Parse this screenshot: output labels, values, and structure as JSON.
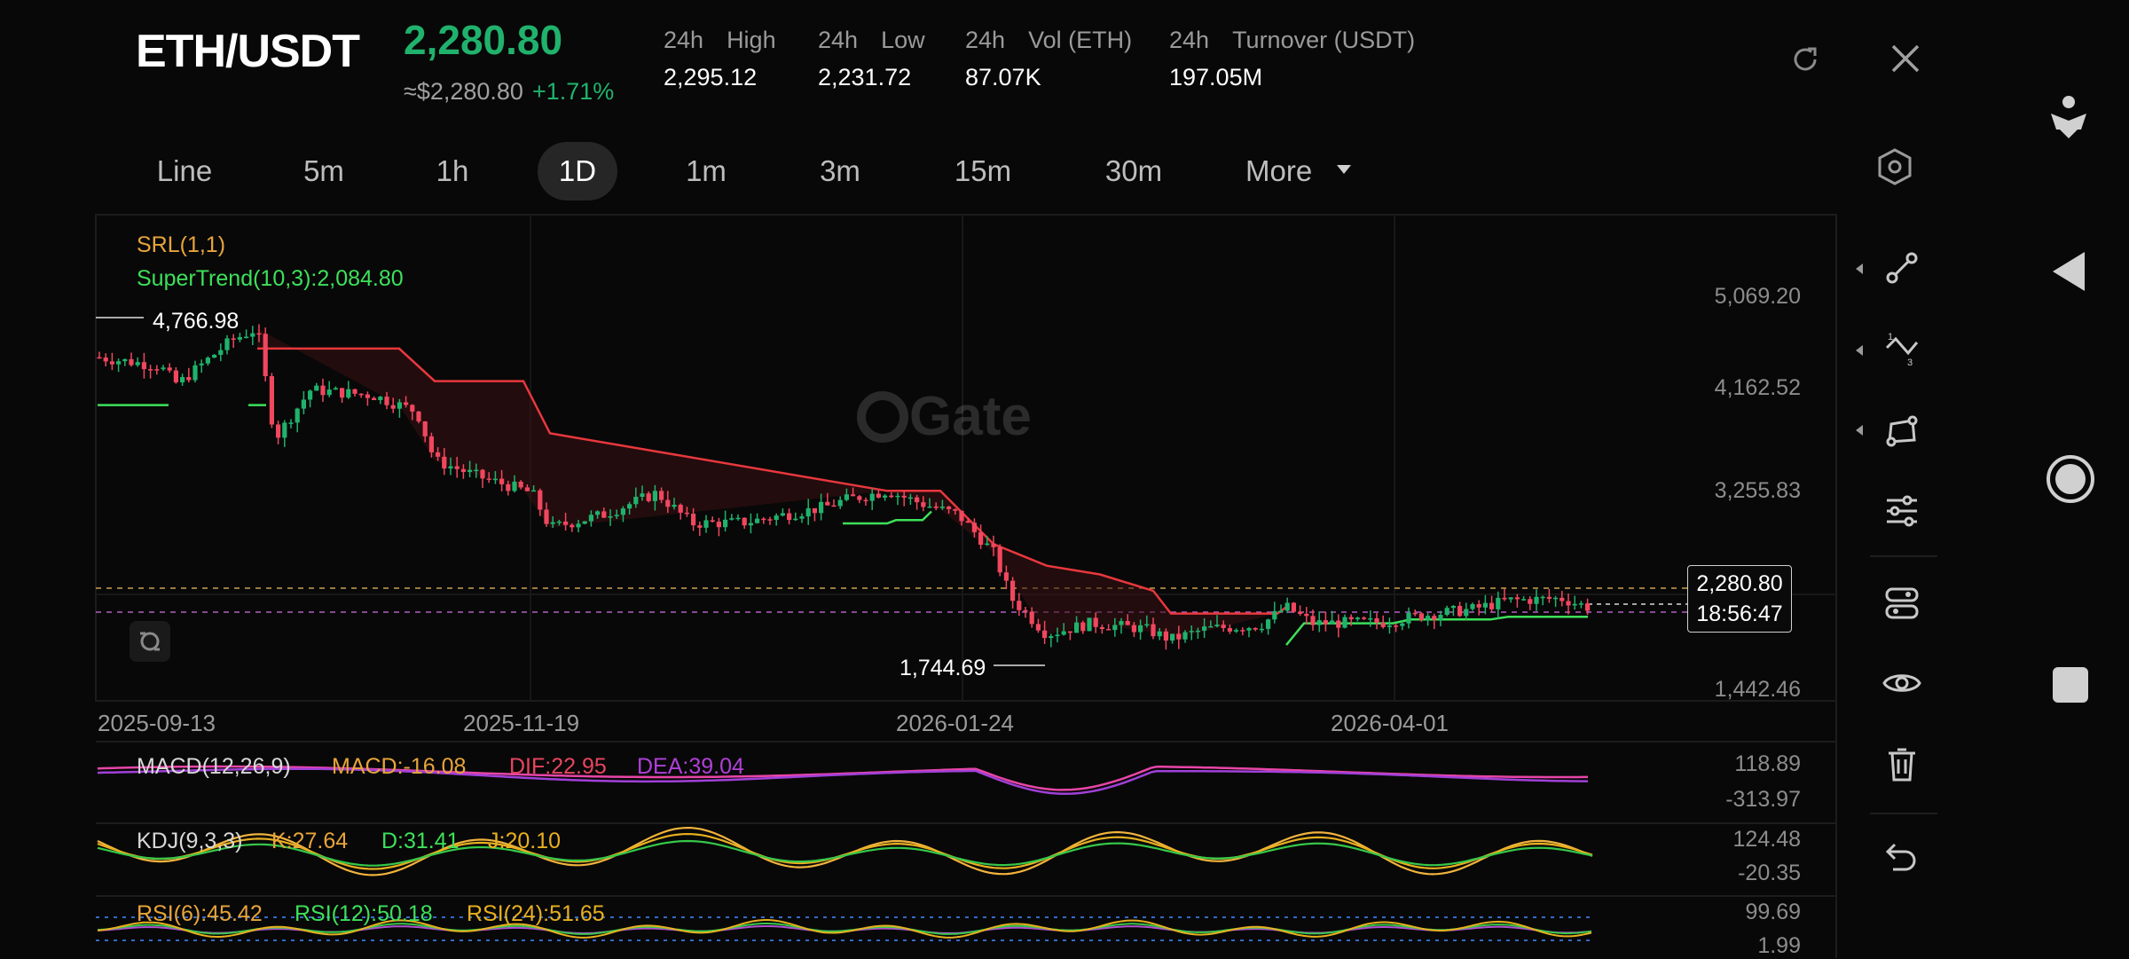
{
  "header": {
    "pair": "ETH/USDT",
    "last_price": "2,280.80",
    "usd_equiv": "≈$2,280.80",
    "change_pct": "+1.71%",
    "stats": [
      {
        "key": "24h",
        "label": "High",
        "value": "2,295.12"
      },
      {
        "key": "24h",
        "label": "Low",
        "value": "2,231.72"
      },
      {
        "key": "24h",
        "label": "Vol (ETH)",
        "value": "87.07K"
      },
      {
        "key": "24h",
        "label": "Turnover (USDT)",
        "value": "197.05M"
      }
    ],
    "icons": [
      "rotate-icon",
      "close-icon"
    ]
  },
  "toolbar": {
    "tabs": [
      "Line",
      "5m",
      "1h",
      "1D",
      "1m",
      "3m",
      "15m",
      "30m",
      "More"
    ],
    "active_tab": "1D",
    "settings_icon": "hexagon-settings-icon"
  },
  "main_chart": {
    "indicator_srl": "SRL(1,1)",
    "indicator_supertrend": "SuperTrend(10,3):2,084.80",
    "price_axis": [
      "5,069.20",
      "4,162.52",
      "3,255.83",
      "2,280.80",
      "1,442.46"
    ],
    "date_axis": [
      "2025-09-13",
      "2025-11-19",
      "2026-01-24",
      "2026-04-01"
    ],
    "high_marker": "4,766.98",
    "low_marker": "1,744.69",
    "current_price_tag": "2,280.80",
    "countdown": "18:56:47",
    "watermark": "Gate",
    "colors": {
      "up": "#20b26c",
      "down": "#f0475f",
      "supertrend_up": "#3de05a",
      "supertrend_down": "#e8383d"
    }
  },
  "macd": {
    "label": "MACD(12,26,9)",
    "macd": "MACD:-16.08",
    "dif": "DIF:22.95",
    "dea": "DEA:39.04",
    "axis": [
      "118.89",
      "-313.97"
    ]
  },
  "kdj": {
    "label": "KDJ(9,3,3)",
    "k": "K:27.64",
    "d": "D:31.41",
    "j": "J:20.10",
    "axis": [
      "124.48",
      "-20.35"
    ]
  },
  "rsi": {
    "r6": "RSI(6):45.42",
    "r12": "RSI(12):50.18",
    "r24": "RSI(24):51.65",
    "axis": [
      "99.69",
      "1.99"
    ]
  },
  "drawing_tools": [
    "trend-line-icon",
    "fibonacci-icon",
    "shape-icon",
    "indicator-settings-icon",
    "layers-icon",
    "eye-icon",
    "trash-icon",
    "undo-icon"
  ],
  "system_nav": [
    "accessibility-icon",
    "back-icon",
    "home-icon",
    "recents-icon"
  ]
}
